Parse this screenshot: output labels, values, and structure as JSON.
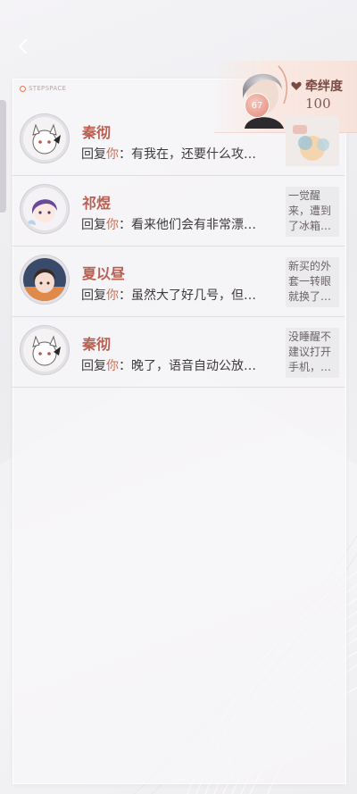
{
  "brand": {
    "text": "STEPSPACE"
  },
  "bond": {
    "label": "牵绊度",
    "value": "100",
    "level": "67"
  },
  "messages": [
    {
      "name": "秦彻",
      "reply_prefix": "回复",
      "you": "你",
      "reply_text": "：有我在，还要什么攻…",
      "thumb_type": "image",
      "thumb_text": ""
    },
    {
      "name": "祁煜",
      "reply_prefix": "回复",
      "you": "你",
      "reply_text": "：看来他们会有非常漂…",
      "thumb_type": "text",
      "thumb_text": "一觉醒来，遭到了冰箱…"
    },
    {
      "name": "夏以昼",
      "reply_prefix": "回复",
      "you": "你",
      "reply_text": "：虽然大了好几号，但…",
      "thumb_type": "text",
      "thumb_text": "新买的外套一转眼就换了…"
    },
    {
      "name": "秦彻",
      "reply_prefix": "回复",
      "you": "你",
      "reply_text": "：晚了，语音自动公放…",
      "thumb_type": "text",
      "thumb_text": "没睡醒不建议打开手机，…"
    }
  ]
}
